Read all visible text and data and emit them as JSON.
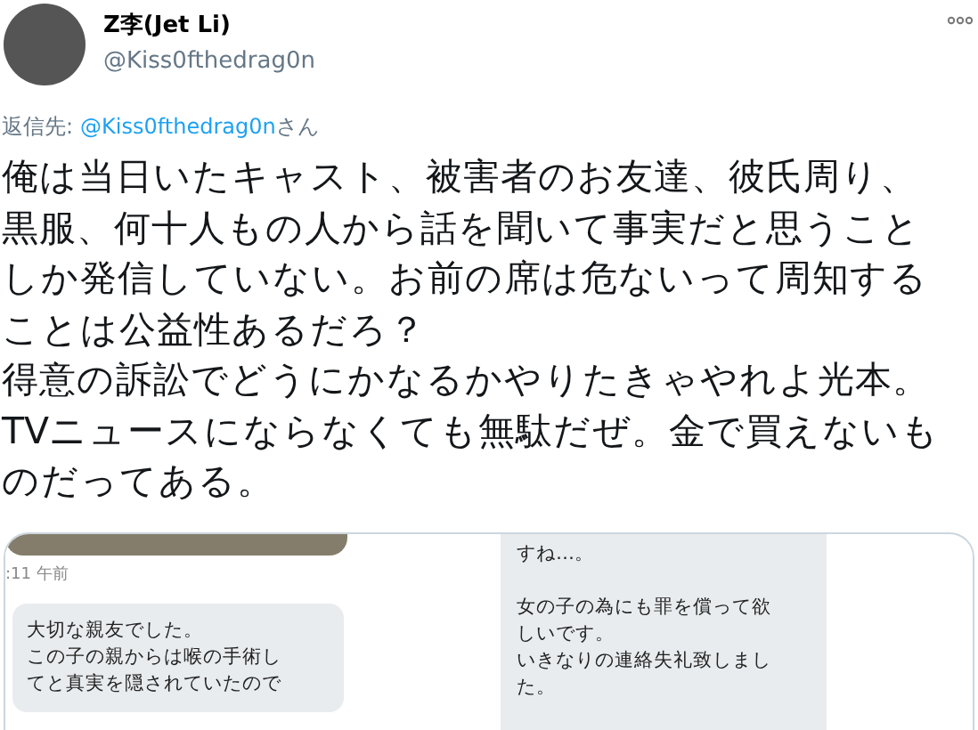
{
  "author": {
    "name": "Z李(Jet Li)",
    "handle": "@Kiss0fthedrag0n"
  },
  "reply_to": {
    "label": "返信先:",
    "handle": "@Kiss0fthedrag0n",
    "suffix": "さん"
  },
  "tweet_lines": [
    "俺は当日いたキャスト、被害者のお友達、彼氏周り、",
    "黒服、何十人もの人から話を聞いて事実だと思うこと",
    "しか発信していない。お前の席は危ないって周知する",
    "ことは公益性あるだろ？",
    "得意の訴訟でどうにかなるかやりたきゃやれよ光本。",
    "TVニュースにならなくても無駄だぜ。金で買えないも",
    "のだってある。"
  ],
  "images": [
    {
      "kind": "chat-left",
      "timestamp": ":11 午前",
      "paragraphs": [
        [
          "大切な親友でした。",
          "この子の親からは喉の手術し",
          "てと真実を隠されていたので"
        ]
      ]
    },
    {
      "kind": "chat-right",
      "paragraphs": [
        [
          "すね…。"
        ],
        [
          "女の子の為にも罪を償って欲",
          "しいです。",
          "いきなりの連絡失礼致しまし",
          "た。"
        ]
      ]
    }
  ]
}
